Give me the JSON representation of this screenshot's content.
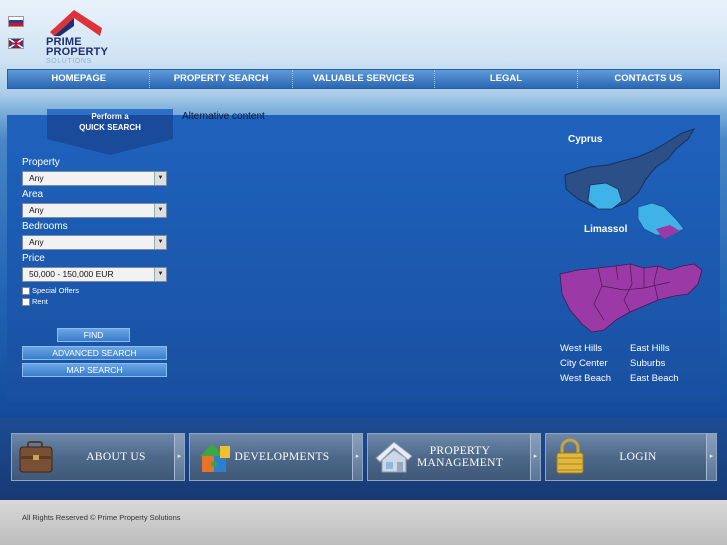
{
  "header": {
    "logo_line1": "PRIME",
    "logo_line2": "PROPERTY",
    "logo_line3": "SOLUTIONS",
    "languages": [
      "ru",
      "en"
    ]
  },
  "nav": {
    "items": [
      "HOMEPAGE",
      "PROPERTY SEARCH",
      "VALUABLE SERVICES",
      "LEGAL",
      "CONTACTS US"
    ]
  },
  "quick_search": {
    "tab_line1": "Perform a",
    "tab_line2": "QUICK SEARCH",
    "alt_content": "Alternative content",
    "property_label": "Property",
    "property_value": "Any",
    "area_label": "Area",
    "area_value": "Any",
    "bedrooms_label": "Bedrooms",
    "bedrooms_value": "Any",
    "price_label": "Price",
    "price_value": "50,000 - 150,000 EUR",
    "special_offers_label": "Special Offers",
    "rent_label": "Rent",
    "find_label": "FIND",
    "advanced_label": "ADVANCED SEARCH",
    "map_label": "MAP SEARCH"
  },
  "map": {
    "cyprus_label": "Cyprus",
    "limassol_label": "Limassol",
    "regions": [
      "West Hills",
      "East Hills",
      "City Center",
      "Suburbs",
      "West Beach",
      "East Beach"
    ]
  },
  "tiles": {
    "about": "ABOUT US",
    "developments": "DEVELOPMENTS",
    "pm_line1": "PROPERTY",
    "pm_line2": "MANAGEMENT",
    "login": "LOGIN"
  },
  "footer": {
    "text": "All Rights Reserved © Prime Property Solutions"
  },
  "colors": {
    "accent": "#1f62bd",
    "map_purple": "#9b3aa6",
    "map_light_blue": "#3fb2e8",
    "map_dark": "#2b4f86"
  }
}
